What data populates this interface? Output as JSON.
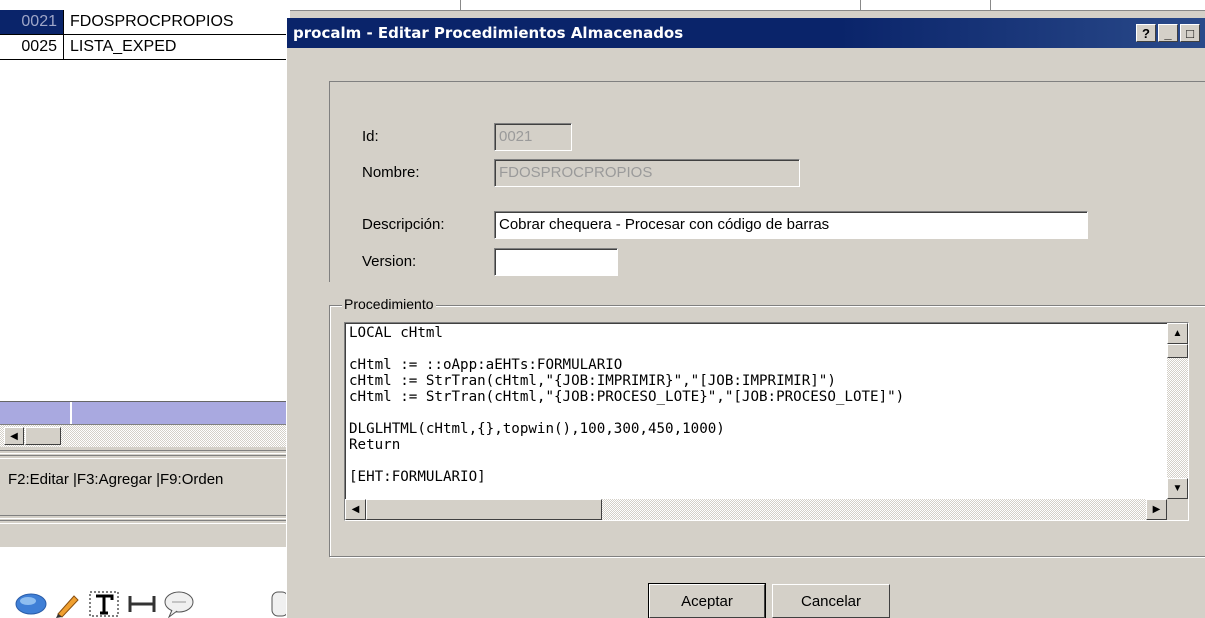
{
  "background_app": {
    "list": [
      {
        "id": "0021",
        "name": "FDOSPROCPROPIOS",
        "selected": true
      },
      {
        "id": "0025",
        "name": "LISTA_EXPED",
        "selected": false
      }
    ],
    "status_text": "F2:Editar |F3:Agregar |F9:Orden",
    "tools": [
      "ellipse-icon",
      "pencil-icon",
      "text-tool-icon",
      "dimension-icon",
      "speech-bubble-icon",
      "note-icon"
    ]
  },
  "dialog": {
    "title": "procalm - Editar Procedimientos Almacenados",
    "title_buttons": {
      "help": "?",
      "minimize": "_",
      "maximize": "□"
    },
    "fields": {
      "id_label": "Id:",
      "id_value": "0021",
      "nombre_label": "Nombre:",
      "nombre_value": "FDOSPROCPROPIOS",
      "descripcion_label": "Descripción:",
      "descripcion_value": "Cobrar chequera - Procesar con código de barras",
      "version_label": "Version:",
      "version_value": ""
    },
    "procedimiento": {
      "legend": "Procedimiento",
      "code": "LOCAL cHtml\n\ncHtml := ::oApp:aEHTs:FORMULARIO\ncHtml := StrTran(cHtml,\"{JOB:IMPRIMIR}\",\"[JOB:IMPRIMIR]\")\ncHtml := StrTran(cHtml,\"{JOB:PROCESO_LOTE}\",\"[JOB:PROCESO_LOTE]\")\n\nDLGLHTML(cHtml,{},topwin(),100,300,450,1000)\nReturn\n\n[EHT:FORMULARIO]"
    },
    "buttons": {
      "ok": "Aceptar",
      "cancel": "Cancelar"
    }
  },
  "colors": {
    "selection": "#0a246a",
    "titlebar": "#0a246a",
    "face": "#d4d0c8",
    "grid_header": "#a9a9e0"
  }
}
